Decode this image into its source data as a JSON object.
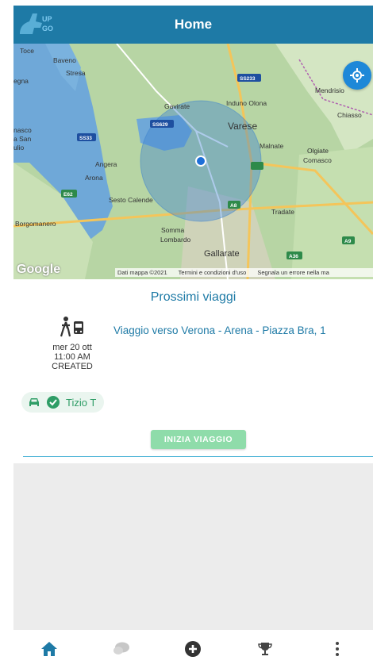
{
  "header": {
    "title": "Home"
  },
  "map": {
    "labels": [
      "Toce",
      "Baveno",
      "Stresa",
      "Mendrisio",
      "Chiasso",
      "SS233",
      "Gavirate",
      "Induno Olona",
      "Varese",
      "SS629",
      "SS33",
      "nasco",
      "a San",
      "ulio",
      "Angera",
      "Arona",
      "Malnate",
      "Olgiate",
      "Comasco",
      "E62",
      "Sesto Calende",
      "A8",
      "Tradate",
      "Borgomanero",
      "Somma",
      "Lombardo",
      "Gallarate",
      "A9",
      "A36",
      "egna"
    ],
    "provider": "Google",
    "attribution": {
      "data": "Dati mappa ©2021",
      "terms": "Termini e condizioni d'uso",
      "report": "Segnala un errore nella ma"
    }
  },
  "upcoming": {
    "title": "Prossimi viaggi",
    "trip": {
      "date": "mer 20 ott",
      "time": "11:00 AM",
      "status": "CREATED",
      "destination": "Viaggio verso Verona - Arena - Piazza Bra, 1",
      "driver": "Tizio T",
      "start_label": "INIZIA VIAGGIO"
    }
  },
  "nav": {
    "icons": [
      "home-icon",
      "chat-icon",
      "add-icon",
      "trophy-icon",
      "more-icon"
    ]
  },
  "colors": {
    "primary": "#1e7aa6",
    "accent": "#1e88d8",
    "green": "#2e9d66",
    "button": "#8fdcaa"
  }
}
